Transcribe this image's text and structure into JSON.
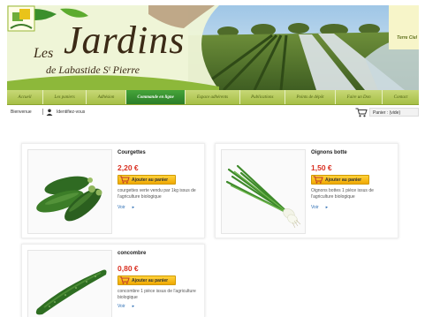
{
  "brand": {
    "les": "Les",
    "word": "Jardins",
    "subtitle": "de Labastide Sᵗ Pierre",
    "partner": "Terre Ciel"
  },
  "nav": {
    "items": [
      {
        "label": "Accueil"
      },
      {
        "label": "Les paniers"
      },
      {
        "label": "Adhésion"
      },
      {
        "label": "Commande en ligne",
        "active": true
      },
      {
        "label": "Espace adhérents"
      },
      {
        "label": "Publications"
      },
      {
        "label": "Points de dépôt"
      },
      {
        "label": "Faire un Don"
      },
      {
        "label": "Contact"
      }
    ]
  },
  "topbar": {
    "welcome": "Bienvenue",
    "login": "Identifiez-vous",
    "cart": "Panier : (vide)"
  },
  "products": [
    {
      "name": "Courgettes",
      "price": "2,20 €",
      "button": "Ajouter au panier",
      "description": "courgettes verte vendu par 1kg issus de l'agriculture biologique",
      "more": "Voir"
    },
    {
      "name": "Oignons botte",
      "price": "1,50 €",
      "button": "Ajouter au panier",
      "description": "Oignons bottes 1 pièce issus de l'agriculture biologique",
      "more": "Voir"
    },
    {
      "name": "concombre",
      "price": "0,80 €",
      "button": "Ajouter au panier",
      "description": "concombre 1 pièce issus de l'agriculture biologique",
      "more": "Voir"
    }
  ],
  "colors": {
    "nav": "#a6bf46",
    "nav_active": "#2a7d27",
    "price": "#d93022",
    "button": "#f0a800",
    "link": "#2e6fb5"
  }
}
